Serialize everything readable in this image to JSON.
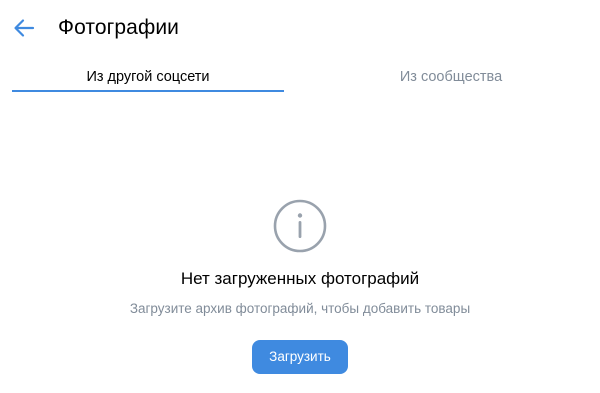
{
  "header": {
    "title": "Фотографии",
    "back_icon": "arrow-left-icon"
  },
  "tabs": [
    {
      "label": "Из другой соцсети",
      "active": true
    },
    {
      "label": "Из сообщества",
      "active": false
    }
  ],
  "placeholder": {
    "icon": "info-circle-icon",
    "title": "Нет загруженных фотографий",
    "text": "Загрузите архив фотографий, чтобы добавить товары",
    "button_label": "Загрузить"
  },
  "colors": {
    "accent": "#3f8ae0",
    "secondary_text": "#818c99",
    "icon_gray": "#99a2ad"
  }
}
